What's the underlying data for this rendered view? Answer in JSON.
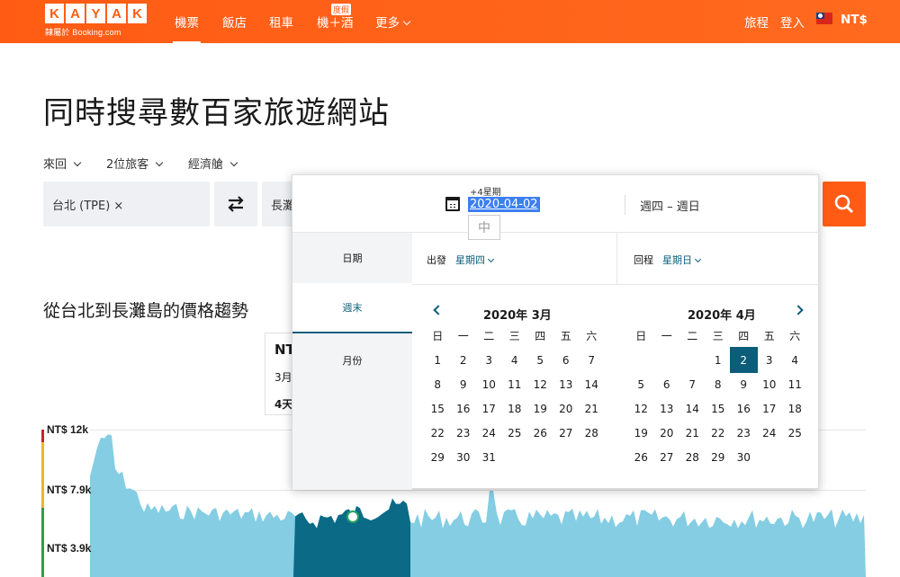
{
  "brand": {
    "letters": [
      "K",
      "A",
      "Y",
      "A",
      "K"
    ],
    "sub": "隸屬於 Booking.com",
    "color": "#ff5b14"
  },
  "nav": {
    "flights": "機票",
    "hotels": "飯店",
    "cars": "租車",
    "packages": "機＋酒",
    "packages_badge": "度假",
    "more": "更多",
    "trips": "旅程",
    "login": "登入",
    "currency": "NT$"
  },
  "hero": {
    "title": "同時搜尋數百家旅遊網站"
  },
  "options": {
    "trip_type": "來回",
    "travelers": "2位旅客",
    "cabin": "經濟艙"
  },
  "search": {
    "origin": "台北 (TPE) ×",
    "destination": "長灘"
  },
  "trend": {
    "title": "從台北到長灘島的價格趨勢",
    "card_price": "NT",
    "card_date": "3月",
    "card_duration": "4天",
    "y_labels": [
      "NT$ 12k",
      "NT$ 7.9k",
      "NT$ 3.9k"
    ],
    "fill_color": "#84cde3",
    "highlight_color": "#0b6b86"
  },
  "calendar": {
    "plus_weeks": "+4星期",
    "selected_date": "2020-04-02",
    "ime_indicator": "中",
    "range": "週四 – 週日",
    "tabs": [
      "日期",
      "週末",
      "月份"
    ],
    "active_tab": "週末",
    "depart_label": "出發",
    "depart_value": "星期四",
    "return_label": "回程",
    "return_value": "星期日",
    "weekdays": [
      "日",
      "一",
      "二",
      "三",
      "四",
      "五",
      "六"
    ],
    "months": [
      {
        "title": "2020年 3月",
        "lead_blanks": 0,
        "days": [
          "1",
          "2",
          "3",
          "4",
          "5",
          "6",
          "7",
          "8",
          "9",
          "10",
          "11",
          "12",
          "13",
          "14",
          "15",
          "16",
          "17",
          "18",
          "19",
          "20",
          "21",
          "22",
          "23",
          "24",
          "25",
          "26",
          "27",
          "28",
          "29",
          "30",
          "31"
        ]
      },
      {
        "title": "2020年 4月",
        "lead_blanks": 3,
        "days": [
          "1",
          "2",
          "3",
          "4",
          "5",
          "6",
          "7",
          "8",
          "9",
          "10",
          "11",
          "12",
          "13",
          "14",
          "15",
          "16",
          "17",
          "18",
          "19",
          "20",
          "21",
          "22",
          "23",
          "24",
          "25",
          "26",
          "27",
          "28",
          "29",
          "30"
        ],
        "selected": "2"
      }
    ],
    "accent_color": "#0b5d79"
  }
}
